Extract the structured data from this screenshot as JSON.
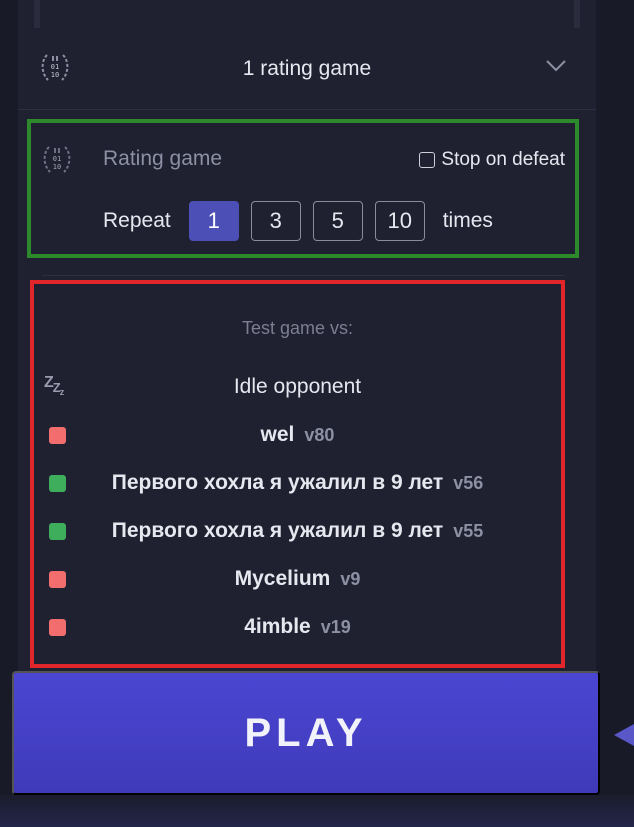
{
  "header": {
    "title": "1 rating game",
    "badge_icon": "laurel-binary-icon",
    "badge_text": [
      "01",
      "10"
    ]
  },
  "rating": {
    "label": "Rating game",
    "stop_on_defeat_label": "Stop on defeat",
    "stop_on_defeat_checked": false,
    "repeat_label": "Repeat",
    "repeat_options": [
      "1",
      "3",
      "5",
      "10"
    ],
    "repeat_selected": "1",
    "times_label": "times"
  },
  "opponents": {
    "heading": "Test game vs:",
    "idle": {
      "name": "Idle opponent",
      "icon": "sleep-zzz-icon"
    },
    "list": [
      {
        "name": "wel",
        "version": "v80",
        "status": "red"
      },
      {
        "name": "Первого хохла я ужалил в 9 лет",
        "version": "v56",
        "status": "green"
      },
      {
        "name": "Первого хохла я ужалил в 9 лет",
        "version": "v55",
        "status": "green"
      },
      {
        "name": "Mycelium",
        "version": "v9",
        "status": "red"
      },
      {
        "name": "4imble",
        "version": "v19",
        "status": "red"
      }
    ]
  },
  "play_button": {
    "label": "PLAY"
  },
  "colors": {
    "background": "#191a27",
    "panel": "#1f2130",
    "accent": "#4b46d2",
    "selected_repeat": "#4c50b6",
    "highlight_green": "#2c8a2d",
    "highlight_red": "#e0262b",
    "status_red": "#f26d6d",
    "status_green": "#3fae5c"
  }
}
